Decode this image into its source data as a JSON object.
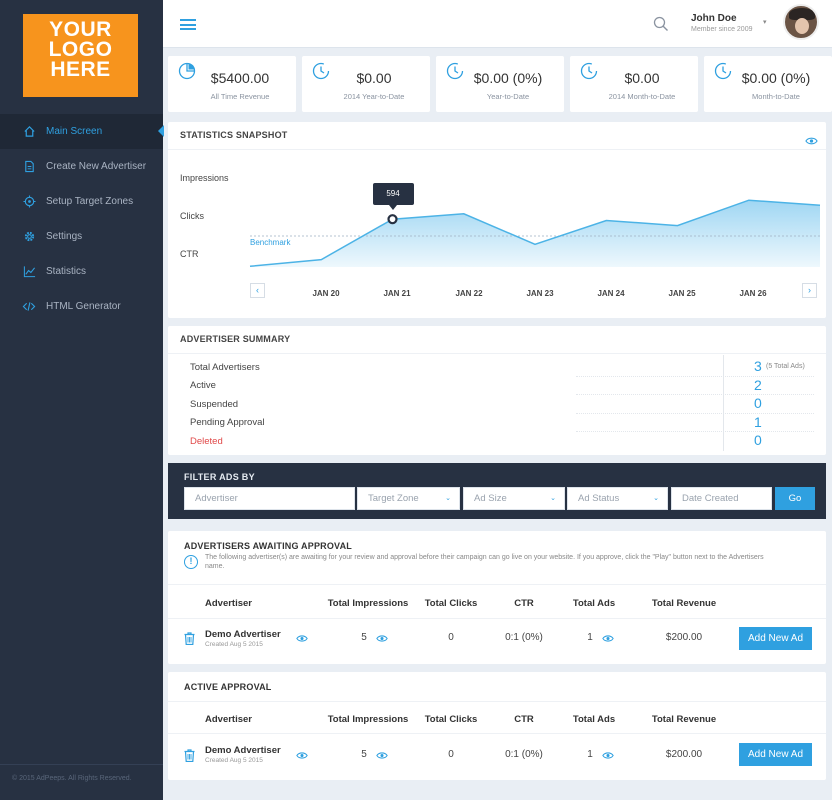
{
  "logo": {
    "line1": "YOUR",
    "line2": "LOGO",
    "line3": "HERE"
  },
  "sidebar": {
    "items": [
      {
        "label": "Main Screen",
        "icon": "home-icon"
      },
      {
        "label": "Create New Advertiser",
        "icon": "file-icon"
      },
      {
        "label": "Setup Target Zones",
        "icon": "target-icon"
      },
      {
        "label": "Settings",
        "icon": "gear-icon"
      },
      {
        "label": "Statistics",
        "icon": "line-chart-icon"
      },
      {
        "label": "HTML Generator",
        "icon": "code-icon"
      }
    ],
    "footer": "© 2015 AdPeeps. All Rights Reserved."
  },
  "header": {
    "user_name": "John Doe",
    "user_sub": "Member since 2009"
  },
  "stats": [
    {
      "value": "$5400.00",
      "label": "All Time Revenue"
    },
    {
      "value": "$0.00",
      "label": "2014 Year-to-Date"
    },
    {
      "value": "$0.00 (0%)",
      "label": "Year-to-Date"
    },
    {
      "value": "$0.00",
      "label": "2014 Month-to-Date"
    },
    {
      "value": "$0.00 (0%)",
      "label": "Month-to-Date"
    }
  ],
  "snapshot": {
    "title": "STATISTICS SNAPSHOT",
    "row_labels": [
      "Impressions",
      "Clicks",
      "CTR"
    ],
    "benchmark_label": "Benchmark",
    "tooltip": "594",
    "prev": "‹",
    "next": "›"
  },
  "chart_data": {
    "type": "area",
    "x": [
      "JAN 20",
      "JAN 21",
      "JAN 22",
      "JAN 23",
      "JAN 24",
      "JAN 25",
      "JAN 26"
    ],
    "series": [
      {
        "values": [
          455,
          475,
          594,
          610,
          520,
          590,
          575,
          650,
          635
        ]
      }
    ],
    "highlight": {
      "x": "JAN 21",
      "value": 594
    },
    "benchmark_line": true,
    "colors": {
      "fill": "#bfe4f7",
      "line": "#4cb3e6"
    }
  },
  "summary": {
    "title": "ADVERTISER SUMMARY",
    "rows": [
      {
        "label": "Total Advertisers",
        "value": "3"
      },
      {
        "label": "Active",
        "value": "2"
      },
      {
        "label": "Suspended",
        "value": "0"
      },
      {
        "label": "Pending Approval",
        "value": "1"
      },
      {
        "label": "Deleted",
        "value": "0"
      }
    ],
    "total_note": "(5 Total Ads)",
    "deleted_color": "#e04848"
  },
  "filter": {
    "title": "FILTER ADS BY",
    "advertiser_placeholder": "Advertiser",
    "zone": "Target Zone",
    "size": "Ad Size",
    "status": "Ad Status",
    "date_placeholder": "Date Created",
    "go": "Go"
  },
  "awaiting": {
    "title": "ADVERTISERS AWAITING APPROVAL",
    "info": "The following advertiser(s) are awaiting for your review and approval before their campaign can go live on your website. If you approve, click the \"Play\" button next to the Advertisers name.",
    "headers": [
      "Advertiser",
      "Total Impressions",
      "Total Clicks",
      "CTR",
      "Total Ads",
      "Total Revenue"
    ],
    "row": {
      "name": "Demo Advertiser",
      "created": "Created Aug 5 2015",
      "impressions": "5",
      "clicks": "0",
      "ctr": "0:1 (0%)",
      "ads": "1",
      "revenue": "$200.00",
      "button": "Add New Ad"
    }
  },
  "active": {
    "title": "ACTIVE APPROVAL",
    "headers": [
      "Advertiser",
      "Total Impressions",
      "Total Clicks",
      "CTR",
      "Total Ads",
      "Total Revenue"
    ],
    "row": {
      "name": "Demo Advertiser",
      "created": "Created Aug 5 2015",
      "impressions": "5",
      "clicks": "0",
      "ctr": "0:1 (0%)",
      "ads": "1",
      "revenue": "$200.00",
      "button": "Add New Ad"
    }
  }
}
